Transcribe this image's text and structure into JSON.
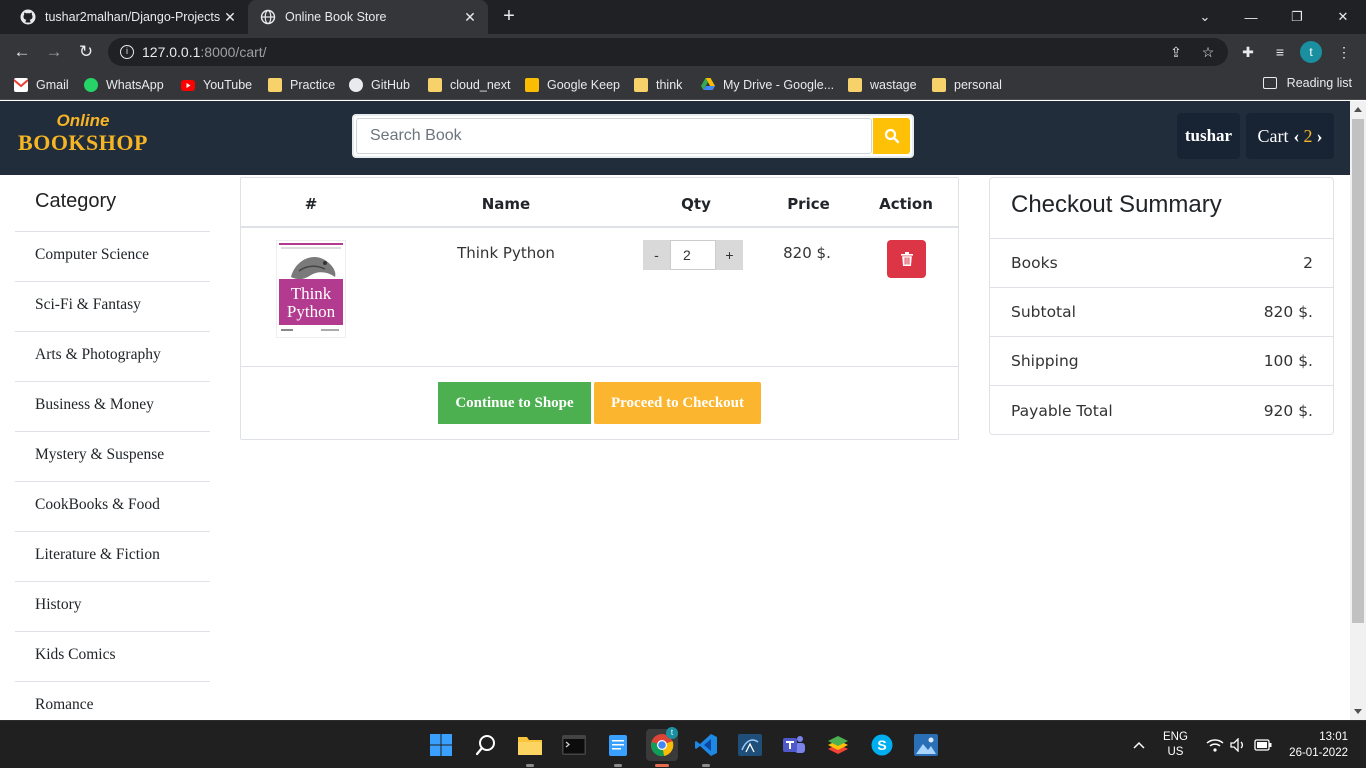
{
  "browser": {
    "tabs": [
      {
        "title": "tushar2malhan/Django-Projects",
        "active": false
      },
      {
        "title": "Online Book Store",
        "active": true
      }
    ],
    "url_host": "127.0.0.1",
    "url_path": ":8000/cart/",
    "profile_initial": "t",
    "bookmarks": [
      {
        "label": "Gmail",
        "icon": "gmail-icon",
        "color": "#ea4335"
      },
      {
        "label": "WhatsApp",
        "icon": "whatsapp-icon",
        "color": "#25d366"
      },
      {
        "label": "YouTube",
        "icon": "youtube-icon",
        "color": "#ff0000"
      },
      {
        "label": "Practice",
        "icon": "folder-icon",
        "color": "#f7d26b"
      },
      {
        "label": "GitHub",
        "icon": "github-icon",
        "color": "#ffffff"
      },
      {
        "label": "cloud_next",
        "icon": "folder-icon",
        "color": "#f7d26b"
      },
      {
        "label": "Google Keep",
        "icon": "google-keep-icon",
        "color": "#fbbc04"
      },
      {
        "label": "think",
        "icon": "folder-icon",
        "color": "#f7d26b"
      },
      {
        "label": "My Drive - Google...",
        "icon": "google-drive-icon",
        "color": "#34a853"
      },
      {
        "label": "wastage",
        "icon": "folder-icon",
        "color": "#f7d26b"
      },
      {
        "label": "personal",
        "icon": "folder-icon",
        "color": "#f7d26b"
      }
    ],
    "reading_list": "Reading list"
  },
  "header": {
    "logo_line1": "Online",
    "logo_line2": "BOOKSHOP",
    "search_placeholder": "Search Book",
    "user": "tushar",
    "cart_label": "Cart",
    "cart_count": "2",
    "accent": "#f6b524"
  },
  "sidebar": {
    "title": "Category",
    "items": [
      "Computer Science",
      "Sci-Fi & Fantasy",
      "Arts & Photography",
      "Business & Money",
      "Mystery & Suspense",
      "CookBooks & Food",
      "Literature & Fiction",
      "History",
      "Kids Comics",
      "Romance"
    ]
  },
  "cart": {
    "headers": {
      "num": "#",
      "name": "Name",
      "qty": "Qty",
      "price": "Price",
      "action": "Action"
    },
    "items": [
      {
        "name": "Think Python",
        "cover_title_1": "Think",
        "cover_title_2": "Python",
        "qty": "2",
        "price": "820 $."
      }
    ],
    "minus": "-",
    "plus": "+",
    "continue_label": "Continue to Shope",
    "checkout_label": "Proceed to Checkout"
  },
  "summary": {
    "title": "Checkout Summary",
    "rows": [
      {
        "label": "Books",
        "value": "2"
      },
      {
        "label": "Subtotal",
        "value": "820 $."
      },
      {
        "label": "Shipping",
        "value": "100 $."
      },
      {
        "label": "Payable Total",
        "value": "920 $."
      }
    ]
  },
  "taskbar": {
    "lang_1": "ENG",
    "lang_2": "US",
    "time": "13:01",
    "date": "26-01-2022"
  }
}
